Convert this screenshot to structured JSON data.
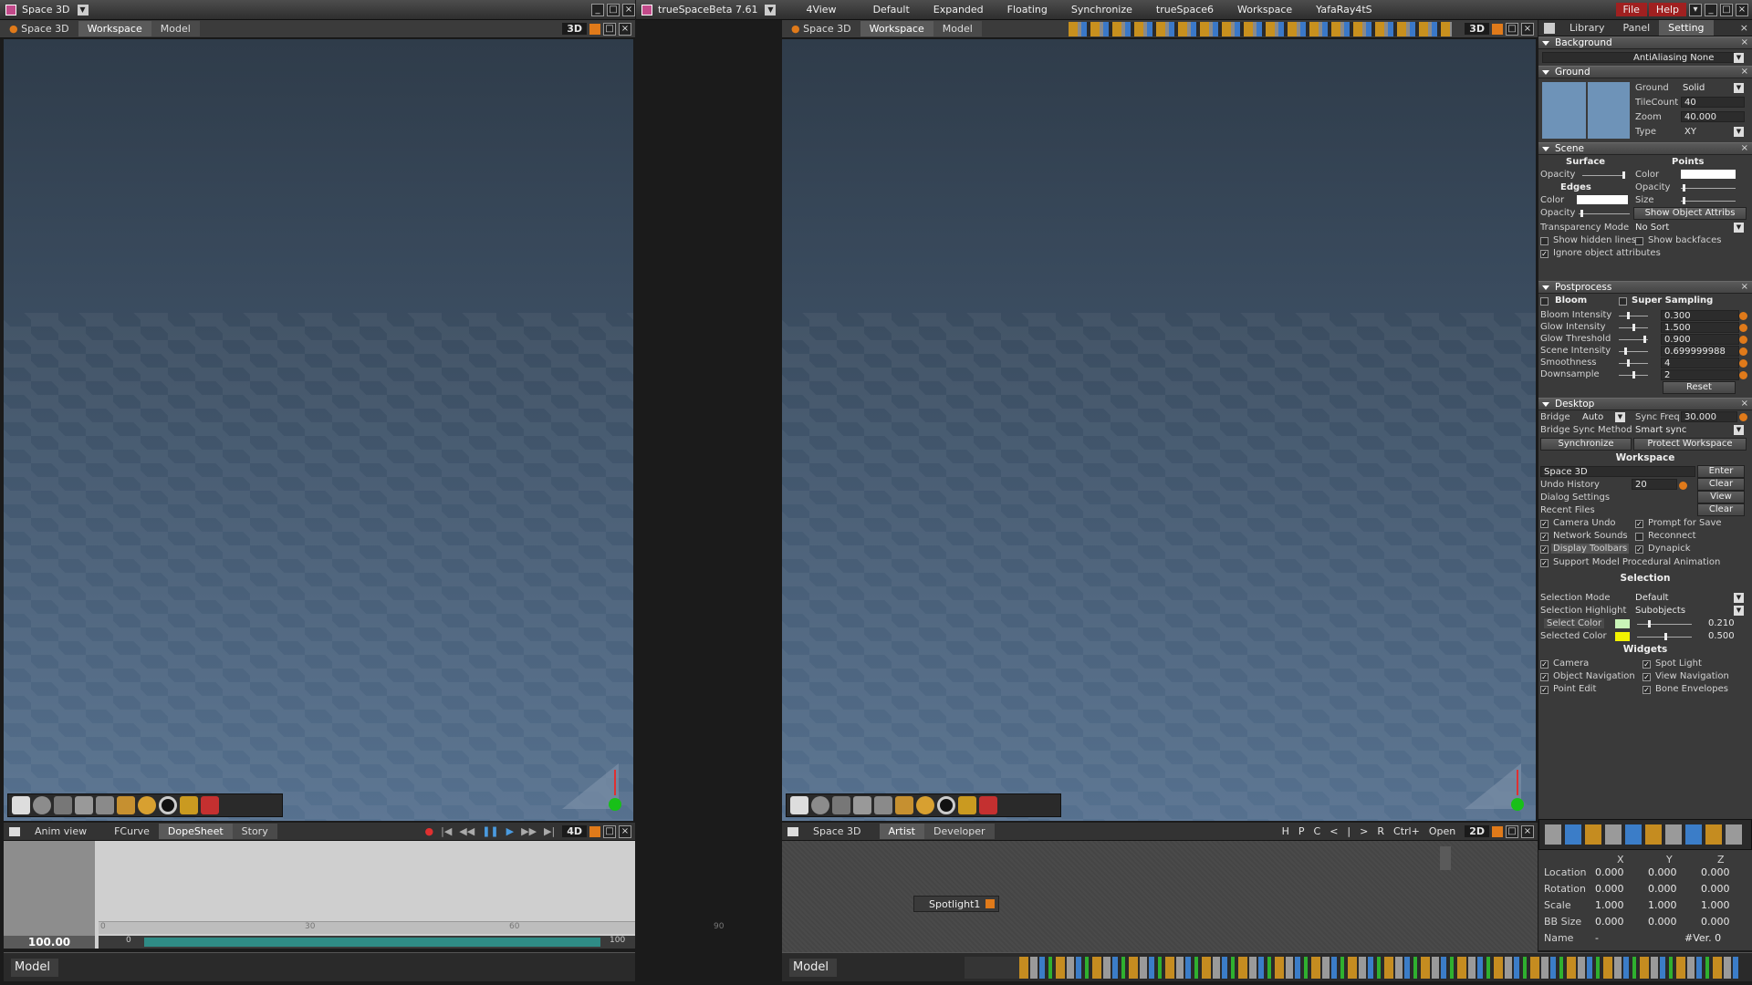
{
  "left_window": {
    "title": "Space 3D",
    "viewport_tabs": [
      "Space 3D",
      "Workspace",
      "Model"
    ],
    "view_mode": "3D",
    "anim": {
      "tabs": [
        "Anim view",
        "FCurve",
        "DopeSheet",
        "Story"
      ],
      "view_mode": "4D",
      "time_value": "100.00",
      "ruler_ticks": [
        "0",
        "30",
        "60",
        "90"
      ],
      "range_start": "0",
      "range_end": "100"
    },
    "status_label": "Model"
  },
  "right_window": {
    "title": "trueSpaceBeta 7.61",
    "menu": [
      "4View",
      "Default",
      "Expanded",
      "Floating",
      "Synchronize",
      "trueSpace6",
      "Workspace",
      "YafaRay4tS"
    ],
    "top_right_menu": [
      "File",
      "Help"
    ],
    "viewport_tabs": [
      "Space 3D",
      "Workspace",
      "Model"
    ],
    "view_mode": "3D",
    "link_editor": {
      "tabs": [
        "Space 3D",
        "Artist",
        "Developer"
      ],
      "buttons": [
        "H",
        "P",
        "C",
        "<",
        "|",
        ">",
        "R",
        "Ctrl+",
        "Open"
      ],
      "view_mode": "2D",
      "node_label": "Spotlight1"
    },
    "status_label": "Model"
  },
  "panel": {
    "tabs": [
      "Library",
      "Panel",
      "Setting"
    ],
    "background": {
      "title": "Background",
      "antialias": "AntiAliasing None"
    },
    "ground": {
      "title": "Ground",
      "rows": [
        {
          "label": "Ground",
          "value": "Solid"
        },
        {
          "label": "TileCount",
          "value": "40"
        },
        {
          "label": "Zoom",
          "value": "40.000"
        },
        {
          "label": "Type",
          "value": "XY"
        }
      ]
    },
    "scene": {
      "title": "Scene",
      "surface": "Surface",
      "points": "Points",
      "edges": "Edges",
      "opacity": "Opacity",
      "color": "Color",
      "size": "Size",
      "show_object_attribs": "Show Object Attribs",
      "transparency_mode_label": "Transparency Mode",
      "transparency_mode_value": "No Sort",
      "show_hidden_lines": "Show hidden lines",
      "show_backfaces": "Show backfaces",
      "ignore_object_attributes": "Ignore object attributes"
    },
    "postprocess": {
      "title": "Postprocess",
      "bloom": "Bloom",
      "super_sampling": "Super Sampling",
      "rows": [
        {
          "label": "Bloom Intensity",
          "value": "0.300",
          "level": 0.3
        },
        {
          "label": "Glow Intensity",
          "value": "1.500",
          "level": 0.5
        },
        {
          "label": "Glow Threshold",
          "value": "0.900",
          "level": 0.9
        },
        {
          "label": "Scene Intensity",
          "value": "0.699999988",
          "level": 0.2
        },
        {
          "label": "Smoothness",
          "value": "4",
          "level": 0.3
        },
        {
          "label": "Downsample",
          "value": "2",
          "level": 0.5
        }
      ],
      "reset": "Reset"
    },
    "desktop": {
      "title": "Desktop",
      "bridge_label": "Bridge",
      "bridge_value": "Auto",
      "sync_freq_label": "Sync Freq",
      "sync_freq_value": "30.000",
      "bridge_sync_method_label": "Bridge Sync Method",
      "bridge_sync_method_value": "Smart sync",
      "synchronize": "Synchronize",
      "protect_workspace": "Protect Workspace",
      "workspace_title": "Workspace",
      "workspace_value": "Space 3D",
      "enter": "Enter",
      "undo_history_label": "Undo History",
      "undo_history_value": "20",
      "clear": "Clear",
      "dialog_settings": "Dialog Settings",
      "view": "View",
      "recent_files": "Recent Files",
      "clear2": "Clear",
      "checks_left": [
        "Camera Undo",
        "Network Sounds",
        "Display Toolbars"
      ],
      "checks_right": [
        "Prompt for Save",
        "Reconnect",
        "Dynapick"
      ],
      "support": "Support Model Procedural Animation"
    },
    "selection": {
      "title": "Selection",
      "mode_label": "Selection Mode",
      "mode_value": "Default",
      "highlight_label": "Selection Highlight",
      "highlight_value": "Subobjects",
      "select_color": "Select Color",
      "select_color_value": "0.210",
      "select_color_swatch": "#c9f5b8",
      "selected_color": "Selected Color",
      "selected_color_value": "0.500",
      "selected_color_swatch": "#f2f200"
    },
    "widgets": {
      "title": "Widgets",
      "left": [
        "Camera",
        "Object Navigation",
        "Point Edit"
      ],
      "right": [
        "Spot Light",
        "View Navigation",
        "Bone Envelopes"
      ]
    },
    "transform": {
      "headers": [
        "X",
        "Y",
        "Z"
      ],
      "rows": [
        {
          "label": "Location",
          "x": "0.000",
          "y": "0.000",
          "z": "0.000"
        },
        {
          "label": "Rotation",
          "x": "0.000",
          "y": "0.000",
          "z": "0.000"
        },
        {
          "label": "Scale",
          "x": "1.000",
          "y": "1.000",
          "z": "1.000"
        },
        {
          "label": "BB Size",
          "x": "0.000",
          "y": "0.000",
          "z": "0.000"
        }
      ],
      "name_label": "Name",
      "name_dash": "-",
      "name_value": "#Ver. 0"
    }
  },
  "colors": {
    "accent_orange": "#e07a1a",
    "progress_teal": "#2f8c86",
    "viewport_top": "#2f3c4a",
    "viewport_bottom": "#56718f"
  }
}
